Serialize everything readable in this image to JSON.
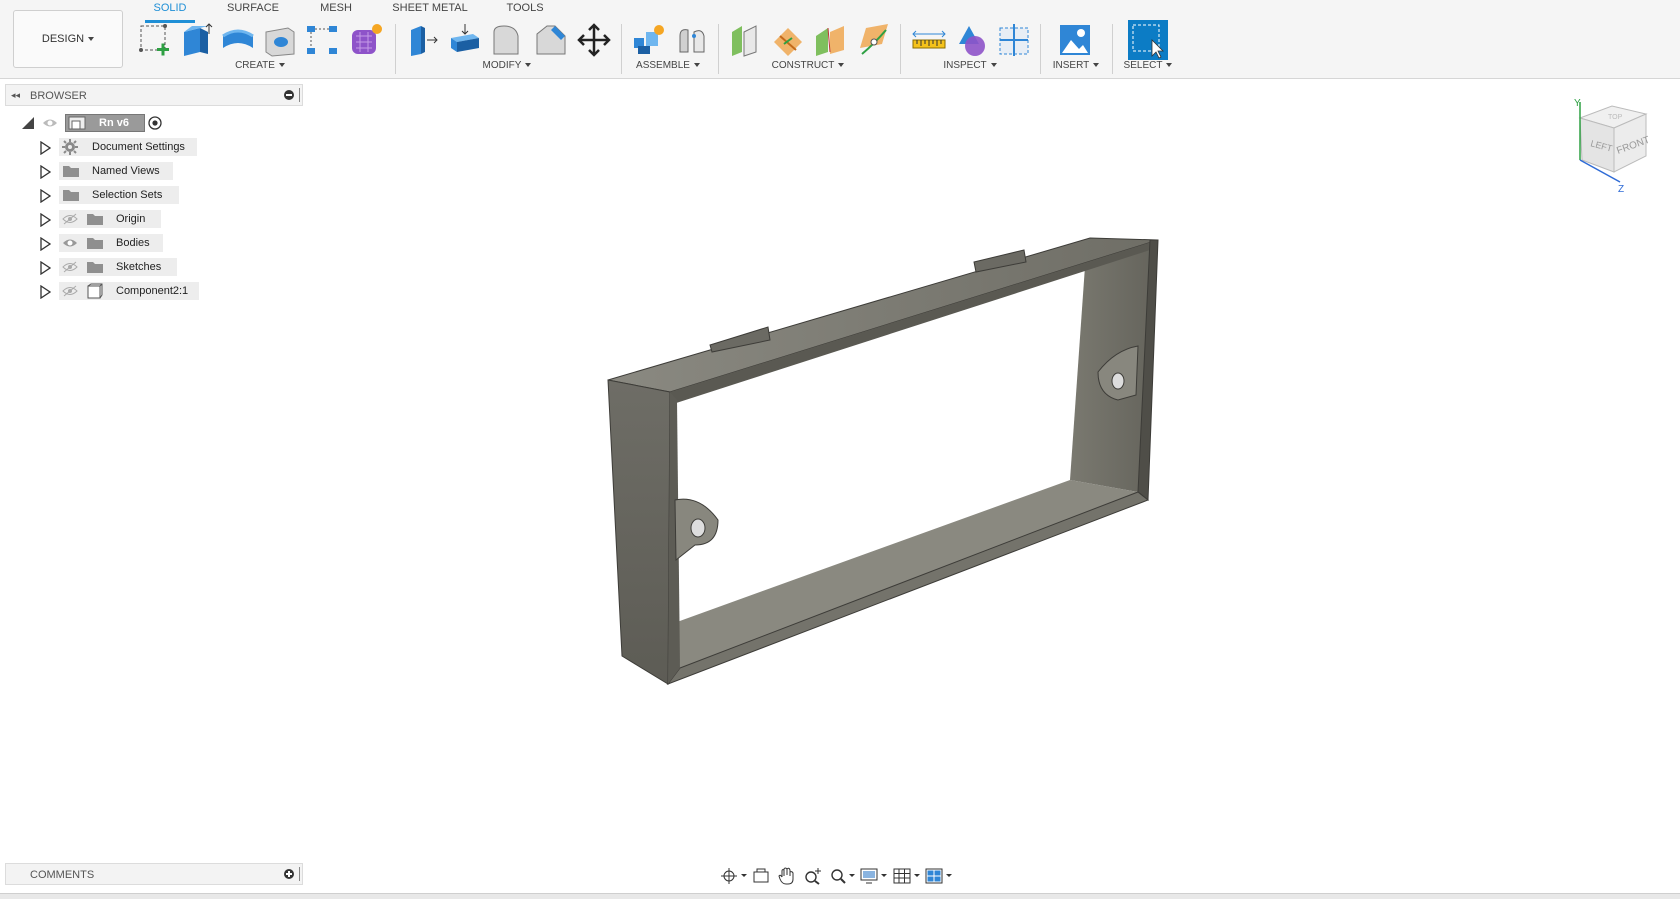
{
  "toolbar": {
    "workspace_label": "DESIGN",
    "tabs": [
      {
        "label": "SOLID",
        "active": true
      },
      {
        "label": "SURFACE",
        "active": false
      },
      {
        "label": "MESH",
        "active": false
      },
      {
        "label": "SHEET METAL",
        "active": false
      },
      {
        "label": "TOOLS",
        "active": false
      }
    ],
    "groups": {
      "create": "CREATE",
      "modify": "MODIFY",
      "assemble": "ASSEMBLE",
      "construct": "CONSTRUCT",
      "inspect": "INSPECT",
      "insert": "INSERT",
      "select": "SELECT"
    },
    "tools": {
      "create": [
        "create-sketch-icon",
        "extrude-icon",
        "revolve-icon",
        "hole-icon",
        "pattern-icon",
        "create-form-icon"
      ],
      "modify": [
        "press-pull-icon",
        "offset-face-icon",
        "fillet-icon",
        "chamfer-icon",
        "move-icon"
      ],
      "assemble": [
        "new-component-icon",
        "joint-icon"
      ],
      "construct": [
        "offset-plane-icon",
        "plane-at-angle-icon",
        "midplane-icon",
        "plane-along-path-icon"
      ],
      "inspect": [
        "measure-icon",
        "interference-icon",
        "section-analysis-icon"
      ],
      "insert": [
        "insert-image-icon"
      ],
      "select": [
        "select-icon"
      ]
    }
  },
  "browser": {
    "title": "BROWSER",
    "root": "Rn v6",
    "items": [
      {
        "label": "Document Settings",
        "icon": "gear-icon",
        "has_eye": false
      },
      {
        "label": "Named Views",
        "icon": "folder-icon",
        "has_eye": false
      },
      {
        "label": "Selection Sets",
        "icon": "folder-icon",
        "has_eye": false
      },
      {
        "label": "Origin",
        "icon": "folder-icon",
        "has_eye": true,
        "visible": false
      },
      {
        "label": "Bodies",
        "icon": "folder-icon",
        "has_eye": true,
        "visible": true
      },
      {
        "label": "Sketches",
        "icon": "folder-icon",
        "has_eye": true,
        "visible": false
      },
      {
        "label": "Component2:1",
        "icon": "component-icon",
        "has_eye": true,
        "visible": false
      }
    ]
  },
  "viewcube": {
    "left": "LEFT",
    "front": "FRONT",
    "top": "TOP",
    "axis_y": "Y",
    "axis_z": "Z"
  },
  "comments": {
    "title": "COMMENTS"
  },
  "colors": {
    "accent": "#1f8fd6",
    "model": "#7c7b72",
    "panel": "#f3f3f3"
  }
}
